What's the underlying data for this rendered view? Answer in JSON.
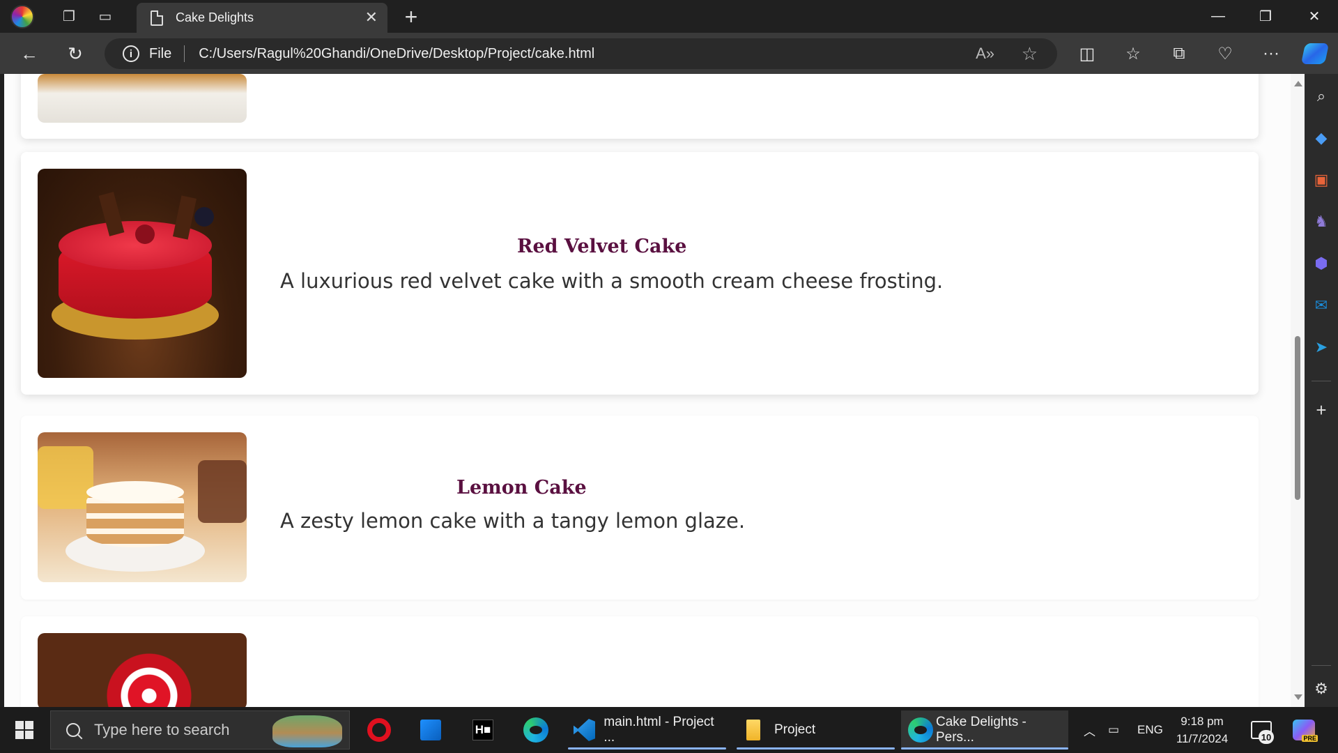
{
  "browser": {
    "tab_title": "Cake Delights",
    "address_scheme_label": "File",
    "address_url": "C:/Users/Ragul%20Ghandi/OneDrive/Desktop/Project/cake.html"
  },
  "page": {
    "cakes": [
      {
        "title": "Red Velvet Cake",
        "description": "A luxurious red velvet cake with a smooth cream cheese frosting."
      },
      {
        "title": "Lemon Cake",
        "description": "A zesty lemon cake with a tangy lemon glaze."
      }
    ]
  },
  "taskbar": {
    "search_placeholder": "Type here to search",
    "apps": [
      {
        "label": "main.html - Project ..."
      },
      {
        "label": "Project"
      },
      {
        "label": "Cake Delights - Pers..."
      }
    ],
    "language": "ENG",
    "time": "9:18 pm",
    "date": "11/7/2024",
    "notification_count": "10",
    "copilot_badge": "PRE"
  },
  "colors": {
    "cake_title": "#5a1040",
    "browser_chrome": "#202020",
    "address_bar": "#3a3a3a"
  }
}
